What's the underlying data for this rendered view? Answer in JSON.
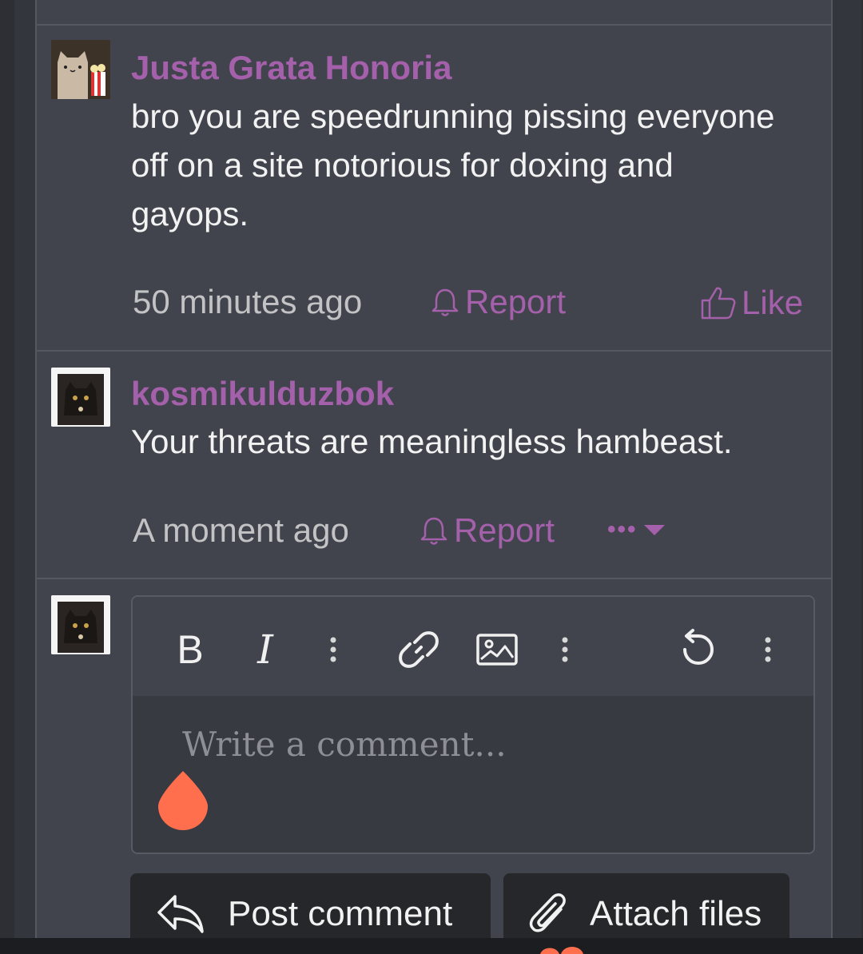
{
  "comments": [
    {
      "username": "Justa Grata Honoria",
      "text": "bro you are speedrunning pissing everyone off on a site notorious for doxing and gayops.",
      "time": "50 minutes ago",
      "report": "Report",
      "like": "Like"
    },
    {
      "username": "kosmikulduzbok",
      "text": "Your threats are meaningless hambeast.",
      "time": "A moment ago",
      "report": "Report",
      "more": "•••"
    }
  ],
  "editor": {
    "placeholder": "Write a comment...",
    "bold": "B",
    "italic": "I"
  },
  "buttons": {
    "post": "Post comment",
    "attach": "Attach files"
  },
  "colors": {
    "accent": "#a460aa",
    "panel": "#41444c",
    "cursor_handle": "#ff6f4e"
  }
}
